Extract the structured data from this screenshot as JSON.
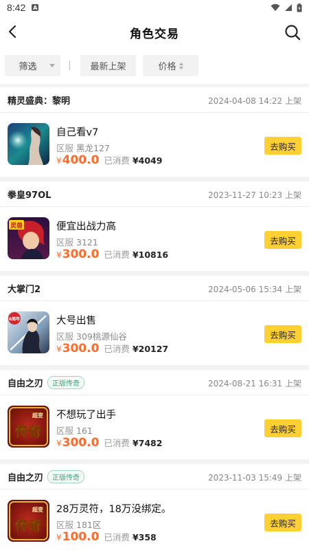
{
  "status_bar": {
    "time": "8:42",
    "notif_letter": "A",
    "icons": [
      "wifi-icon",
      "signal-icon",
      "battery-icon"
    ]
  },
  "header": {
    "title": "角色交易",
    "back_icon": "back-arrow-icon",
    "search_icon": "search-icon"
  },
  "filters": {
    "filter_label": "筛选",
    "newest_label": "最新上架",
    "price_label": "价格"
  },
  "accent_colors": {
    "price": "#ff6a2a",
    "buy_button": "#ffd033",
    "official_tag": "#3aa57a"
  },
  "listings": [
    {
      "game": "精灵盛典：黎明",
      "tag": "",
      "listed_time": "2024-04-08 14:22 上架",
      "title": "自己看v7",
      "server_label": "区服",
      "server": "黑龙127",
      "currency": "¥",
      "price": "400.0",
      "spent_label": "已消费",
      "spent": "¥4049",
      "buy_label": "去购买"
    },
    {
      "game": "拳皇97OL",
      "tag": "",
      "listed_time": "2023-11-27 10:23 上架",
      "title": "便宜出战力高",
      "server_label": "区服",
      "server": "3121",
      "currency": "¥",
      "price": "300.0",
      "spent_label": "已消费",
      "spent": "¥10816",
      "buy_label": "去购买"
    },
    {
      "game": "大掌门2",
      "tag": "",
      "listed_time": "2024-05-06 15:34 上架",
      "title": "大号出售",
      "server_label": "区服",
      "server": "309桃源仙谷",
      "currency": "¥",
      "price": "300.0",
      "spent_label": "已消费",
      "spent": "¥20127",
      "buy_label": "去购买"
    },
    {
      "game": "自由之刃",
      "tag": "正版传奇",
      "listed_time": "2024-08-21 16:31 上架",
      "title": "不想玩了出手",
      "server_label": "区服",
      "server": "161",
      "currency": "¥",
      "price": "300.0",
      "spent_label": "已消费",
      "spent": "¥7482",
      "buy_label": "去购买"
    },
    {
      "game": "自由之刃",
      "tag": "正版传奇",
      "listed_time": "2023-11-03 15:49 上架",
      "title": "28万灵符，18万没绑定。",
      "server_label": "区服",
      "server": "181区",
      "currency": "¥",
      "price": "100.0",
      "spent_label": "已消费",
      "spent": "¥358",
      "buy_label": "去购买"
    }
  ],
  "thumb_text": {
    "kof_badge": "灵兽",
    "dzm_badge": "6周年",
    "legend_small": "超变",
    "legend_big": "传奇"
  }
}
